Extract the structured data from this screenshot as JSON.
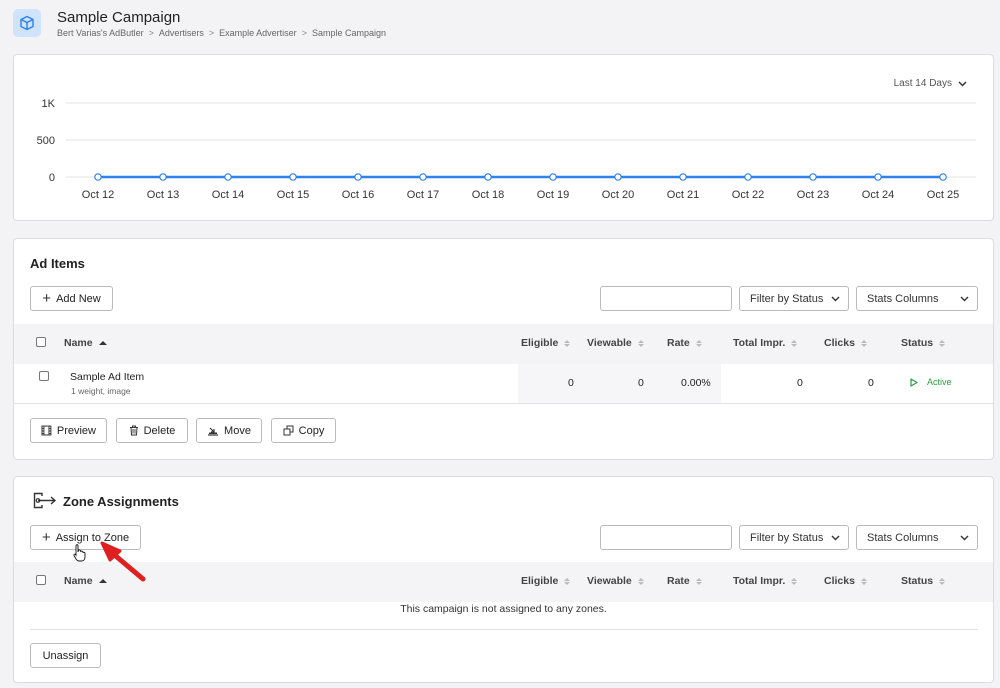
{
  "header": {
    "title": "Sample Campaign",
    "breadcrumb": [
      "Bert Varias's AdButler",
      "Advertisers",
      "Example Advertiser",
      "Sample Campaign"
    ],
    "separator": ">"
  },
  "chart": {
    "range_label": "Last 14 Days",
    "y_tick_labels": [
      "1K",
      "500",
      "0"
    ]
  },
  "chart_data": {
    "type": "line",
    "categories": [
      "Oct 12",
      "Oct 13",
      "Oct 14",
      "Oct 15",
      "Oct 16",
      "Oct 17",
      "Oct 18",
      "Oct 19",
      "Oct 20",
      "Oct 21",
      "Oct 22",
      "Oct 23",
      "Oct 24",
      "Oct 25"
    ],
    "values": [
      0,
      0,
      0,
      0,
      0,
      0,
      0,
      0,
      0,
      0,
      0,
      0,
      0,
      0
    ],
    "ylim": [
      0,
      1000
    ],
    "yticks": [
      0,
      500,
      1000
    ],
    "grid": true,
    "line_color": "#2f80ed",
    "title": "",
    "xlabel": "",
    "ylabel": ""
  },
  "ad_items": {
    "title": "Ad Items",
    "add_new_label": "Add New",
    "search_placeholder": "",
    "filter_label": "Filter by Status",
    "stats_label": "Stats Columns",
    "columns": {
      "name": "Name",
      "eligible": "Eligible",
      "viewable": "Viewable",
      "rate": "Rate",
      "total": "Total Impr.",
      "clicks": "Clicks",
      "status": "Status"
    },
    "rows": [
      {
        "name": "Sample Ad Item",
        "subtext": "1 weight,  image",
        "eligible": "0",
        "viewable": "0",
        "rate": "0.00%",
        "total": "0",
        "clicks": "0",
        "status": "Active"
      }
    ],
    "actions": {
      "preview": "Preview",
      "delete": "Delete",
      "move": "Move",
      "copy": "Copy"
    }
  },
  "zone_assignments": {
    "title": "Zone Assignments",
    "assign_label": "Assign to Zone",
    "filter_label": "Filter by Status",
    "stats_label": "Stats Columns",
    "columns": {
      "name": "Name",
      "eligible": "Eligible",
      "viewable": "Viewable",
      "rate": "Rate",
      "total": "Total Impr.",
      "clicks": "Clicks",
      "status": "Status"
    },
    "empty_message": "This campaign is not assigned to any zones.",
    "unassign_label": "Unassign"
  },
  "colors": {
    "accent": "#2f80ed",
    "status_active": "#2e9d3e",
    "annotation_arrow": "#e02020"
  }
}
